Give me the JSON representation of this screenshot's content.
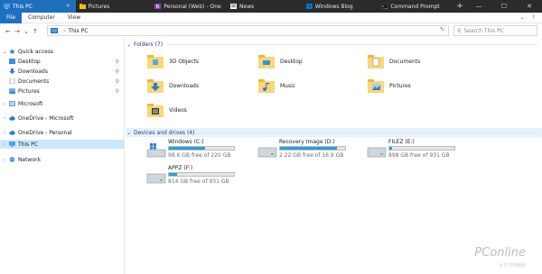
{
  "tabs": [
    {
      "label": "This PC",
      "active": true,
      "color": "#4aa0e6"
    },
    {
      "label": "Pictures",
      "active": false,
      "color": "#f1c40f"
    },
    {
      "label": "Personal (Web) - One",
      "active": false,
      "color": "#8a3fb5"
    },
    {
      "label": "News",
      "active": false,
      "color": "#ffffff"
    },
    {
      "label": "Windows Blog",
      "active": false,
      "color": "#0078d7"
    },
    {
      "label": "Command Prompt",
      "active": false,
      "color": "#333333"
    }
  ],
  "new_tab": "+",
  "window_controls": {
    "minimize": "—",
    "maximize": "☐",
    "close": "✕"
  },
  "ribbon": {
    "file": "File",
    "computer": "Computer",
    "view": "View",
    "collapse": "⌄",
    "help": "?"
  },
  "nav": {
    "back": "←",
    "forward": "→",
    "recent": "⌄",
    "up": "↑"
  },
  "address": {
    "path": "This PC",
    "refresh": "↻"
  },
  "search": {
    "placeholder": "Search This PC",
    "icon": "search-icon"
  },
  "sidebar": {
    "quick_access": "Quick access",
    "items": [
      {
        "label": "Desktop",
        "pinned": true
      },
      {
        "label": "Downloads",
        "pinned": true
      },
      {
        "label": "Documents",
        "pinned": true
      },
      {
        "label": "Pictures",
        "pinned": true
      }
    ],
    "microsoft": "Microsoft",
    "onedrive_ms": "OneDrive - Microsoft",
    "onedrive_personal": "OneDrive - Personal",
    "this_pc": "This PC",
    "network": "Network",
    "pin_glyph": "📌"
  },
  "folders_header": "Folders (7)",
  "folders": [
    {
      "name": "3D Objects",
      "icon": "3d-objects-folder-icon"
    },
    {
      "name": "Desktop",
      "icon": "desktop-folder-icon"
    },
    {
      "name": "Documents",
      "icon": "documents-folder-icon"
    },
    {
      "name": "Downloads",
      "icon": "downloads-folder-icon"
    },
    {
      "name": "Music",
      "icon": "music-folder-icon"
    },
    {
      "name": "Pictures",
      "icon": "pictures-folder-icon"
    },
    {
      "name": "Videos",
      "icon": "videos-folder-icon"
    }
  ],
  "drives_header": "Devices and drives (4)",
  "drives": [
    {
      "name": "Windows (C:)",
      "free": "98.6 GB free of 220 GB",
      "used_fraction": 0.55,
      "windows": true
    },
    {
      "name": "Recovery Image (D:)",
      "free": "2.22 GB free of 16.9 GB",
      "used_fraction": 0.87,
      "windows": false
    },
    {
      "name": "FILEZ (E:)",
      "free": "898 GB free of 931 GB",
      "used_fraction": 0.04,
      "windows": false
    },
    {
      "name": "APPZ (F:)",
      "free": "814 GB free of 931 GB",
      "used_fraction": 0.13,
      "windows": false
    }
  ],
  "watermark": "PConline",
  "watermark_sub": "太平洋电脑网"
}
